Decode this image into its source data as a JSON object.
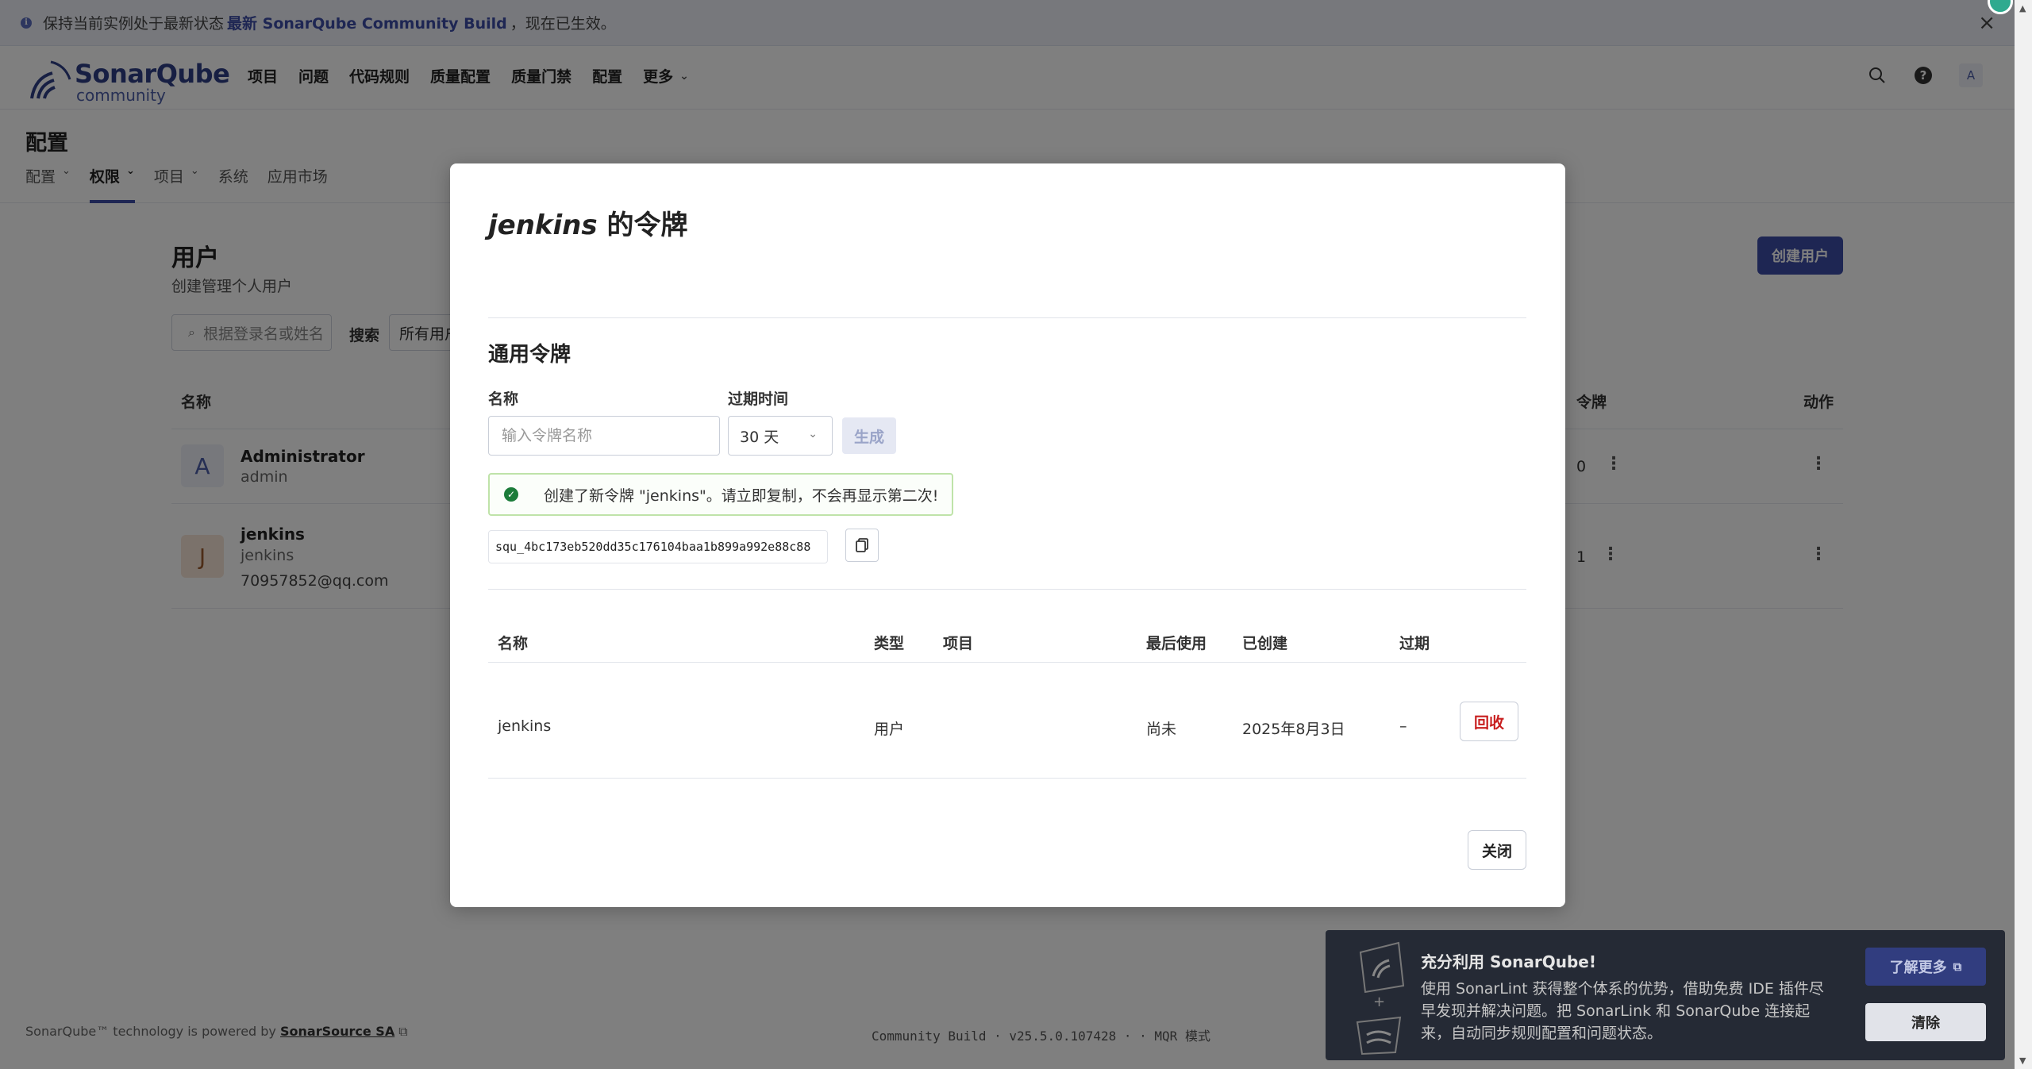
{
  "banner": {
    "text_before": "保持当前实例处于最新状态",
    "highlight": "最新 SonarQube Community Build",
    "text_after": "，现在已生效。"
  },
  "logo": {
    "brand": "SonarQube",
    "edition": "community"
  },
  "nav": {
    "items": [
      "项目",
      "问题",
      "代码规则",
      "质量配置",
      "质量门禁",
      "配置",
      "更多"
    ],
    "avatar_letter": "A",
    "help_glyph": "?"
  },
  "page": {
    "title": "配置",
    "subnav": [
      "配置",
      "权限",
      "项目",
      "系统",
      "应用市场"
    ]
  },
  "users": {
    "title": "用户",
    "subtitle": "创建管理个人用户",
    "create_button": "创建用户",
    "search_placeholder": "根据登录名或姓名",
    "search_label": "搜索",
    "filter_value": "所有用户",
    "col_name": "名称",
    "col_tokens": "令牌",
    "col_actions": "动作",
    "rows": [
      {
        "avatar": "A",
        "name": "Administrator",
        "login": "admin",
        "email": "",
        "tokens": "0"
      },
      {
        "avatar": "J",
        "name": "jenkins",
        "login": "jenkins",
        "email": "70957852@qq.com",
        "tokens": "1"
      }
    ]
  },
  "footer": {
    "powered_text": "SonarQube™ technology is powered by",
    "powered_link": "SonarSource SA",
    "build": "Community Build · v25.5.0.107428 · · MQR 模式"
  },
  "toast": {
    "title": "充分利用 SonarQube!",
    "body": "使用 SonarLint 获得整个体系的优势，借助免费 IDE 插件尽早发现并解决问题。把 SonarLink 和 SonarQube 连接起来，自动同步规则配置和问题状态。",
    "learn_more": "了解更多",
    "clear": "清除"
  },
  "modal": {
    "title_user": "jenkins",
    "title_suffix": " 的令牌",
    "section": "通用令牌",
    "name_label": "名称",
    "name_placeholder": "输入令牌名称",
    "expiry_label": "过期时间",
    "expiry_value": "30 天",
    "generate": "生成",
    "alert": "创建了新令牌 \"jenkins\"。请立即复制，不会再显示第二次!",
    "token": "squ_4bc173eb520dd35c176104baa1b899a992e88c88",
    "table_headers": {
      "name": "名称",
      "type": "类型",
      "project": "项目",
      "last_used": "最后使用",
      "created": "已创建",
      "expires": "过期"
    },
    "table_row": {
      "name": "jenkins",
      "type": "用户",
      "project": "",
      "last_used": "尚未",
      "created": "2025年8月3日",
      "expires": "–"
    },
    "revoke": "回收",
    "close": "关闭"
  },
  "colors": {
    "accent": "#3c4ca6",
    "danger": "#c81e1e",
    "success": "#1c7c3a"
  }
}
